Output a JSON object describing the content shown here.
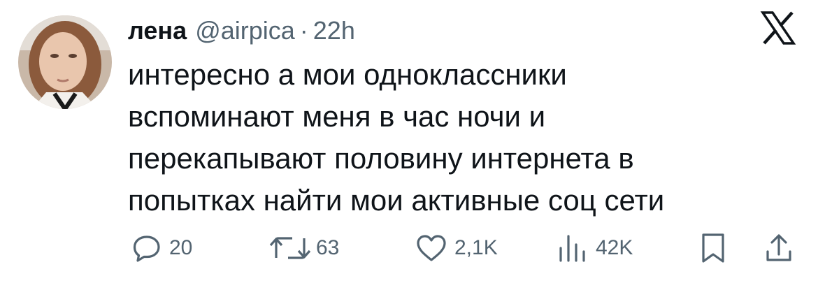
{
  "tweet": {
    "author_name": "лена",
    "handle": "@airpica",
    "separator": "·",
    "time": "22h",
    "text_lines": [
      "интересно а мои одноклассники",
      "вспоминают меня в час ночи и",
      "перекапывают половину интернета в",
      "попытках найти мои активные соц сети"
    ]
  },
  "actions": {
    "replies": "20",
    "reposts": "63",
    "likes": "2,1K",
    "views": "42K"
  },
  "icons": {
    "logo": "x-logo-icon",
    "reply": "speech-bubble-icon",
    "repost": "repost-arrows-icon",
    "like": "heart-icon",
    "views": "bar-chart-icon",
    "bookmark": "bookmark-icon",
    "share": "share-upload-icon"
  },
  "colors": {
    "text": "#0f1419",
    "secondary": "#536471",
    "background": "#ffffff"
  }
}
